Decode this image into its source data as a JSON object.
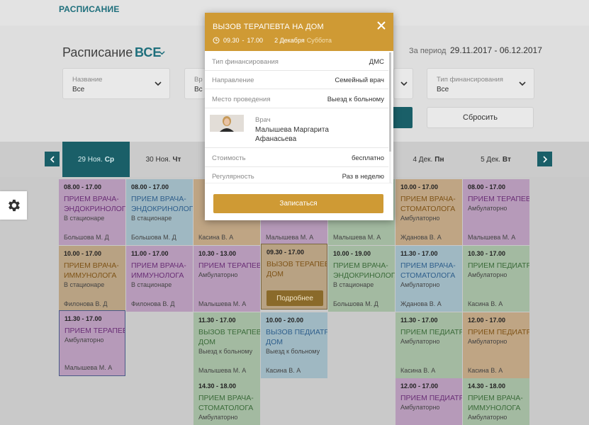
{
  "header": {
    "brand": "РАСПИСАНИЕ"
  },
  "schedule": {
    "title": "Расписание",
    "filter_all": "ВСЕ"
  },
  "period": {
    "label": "За период",
    "value": "29.11.2017 - 06.12.2017"
  },
  "filters": [
    {
      "label": "Название",
      "value": "Все"
    },
    {
      "label": "Вр",
      "value": "Вс"
    },
    {
      "label": "Тип финансирования",
      "value": "Все"
    }
  ],
  "actions": {
    "reset_label": "Сбросить"
  },
  "days": [
    {
      "date": "29 Ноя.",
      "weekday": "Ср"
    },
    {
      "date": "30 Ноя.",
      "weekday": "Чт"
    },
    {
      "date": "4 Дек.",
      "weekday": "Пн"
    },
    {
      "date": "5 Дек.",
      "weekday": "Вт"
    }
  ],
  "cells": [
    {
      "time": "08.00 - 17.00",
      "title": "ПРИЕМ ВРАЧА-ЭНДОКРИНОЛОГА",
      "place": "В стационаре",
      "doctor": "Большова М. Д"
    },
    {
      "time": "10.00 - 17.00",
      "title": "ПРИЕМ ВРАЧА-ИММУНОЛОГА",
      "place": "В стационаре",
      "doctor": "Филонова В. Д"
    },
    {
      "time": "11.30 - 17.00",
      "title": "ПРИЕМ ТЕРАПЕВТА",
      "place": "Амбулаторно",
      "doctor": "Малышева М. А"
    },
    {
      "time": "",
      "title": "ПРИЕМ ВРАЧА-ЭНДОКРИНОЛОГА",
      "place": "В стационаре",
      "doctor": "Большова М. Д"
    },
    {
      "time": "11.00 - 17.00",
      "title": "ПРИЕМ ВРАЧА-ИММУНОЛОГА",
      "place": "В стационаре",
      "doctor": "Филонова В. Д"
    },
    {
      "time": "",
      "title": "",
      "place": "",
      "doctor": "Касина В. А"
    },
    {
      "time": "10.30 - 13.00",
      "title": "ПРИЕМ ТЕРАПЕВТА",
      "place": "Амбулаторно",
      "doctor": "Малышева М. А"
    },
    {
      "time": "11.30 - 17.00",
      "title": "ВЫЗОВ ТЕРАПЕВТА НА ДОМ",
      "place": "Выезд к больному",
      "doctor": "Малышева М. А"
    },
    {
      "time": "14.30 - 18.00",
      "title": "ПРИЕМ ВРАЧА-СТОМАТОЛОГА",
      "place": "Амбулаторно",
      "doctor": ""
    },
    {
      "time": "",
      "title": "",
      "place": "",
      "doctor": "Малышева М. А"
    },
    {
      "time": "09.30 - 17.00",
      "title": "ВЫЗОВ ТЕРАПЕВТА НА ДОМ",
      "place": "",
      "doctor": ""
    },
    {
      "time": "10.00 - 20.00",
      "title": "ВЫЗОВ ПЕДИАТРА НА ДОМ",
      "place": "Выезд к больному",
      "doctor": "Касина В. А"
    },
    {
      "time": "",
      "title": "",
      "place": "",
      "doctor": "Малышева М. А"
    },
    {
      "time": "10.00 - 19.00",
      "title": "ПРИЕМ ВРАЧА-ЭНДОКРИНОЛОГА",
      "place": "В стационаре",
      "doctor": "Большова М. Д"
    },
    {
      "time": "10.00 - 17.00",
      "title": "ПРИЕМ ВРАЧА-СТОМАТОЛОГА",
      "place": "Амбулаторно",
      "doctor": "Жданова В. А"
    },
    {
      "time": "11.30 - 17.00",
      "title": "ПРИЕМ ВРАЧА-СТОМАТОЛОГА",
      "place": "Амбулаторно",
      "doctor": "Жданова В. А"
    },
    {
      "time": "11.30 - 17.00",
      "title": "ПРИЕМ ПЕДИАТРА",
      "place": "Амбулаторно",
      "doctor": "Касина В. А"
    },
    {
      "time": "12.00 - 17.00",
      "title": "ПРИЕМ ПЕДИАТРА",
      "place": "Амбулаторно",
      "doctor": ""
    },
    {
      "time": "08.00 - 17.00",
      "title": "ПРИЕМ ТЕРАПЕВТА",
      "place": "Амбулаторно",
      "doctor": "Малышева М. А"
    },
    {
      "time": "10.30 - 17.00",
      "title": "ПРИЕМ ПЕДИАТРА",
      "place": "Амбулаторно",
      "doctor": "Касина В. А"
    },
    {
      "time": "12.00 - 17.00",
      "title": "ПРИЕМ ПЕДИАТРА",
      "place": "Амбулаторно",
      "doctor": "Касина В. А"
    },
    {
      "time": "14.30 - 18.00",
      "title": "ПРИЕМ ВРАЧА-ИММУНОЛОГА",
      "place": "Амбулаторно",
      "doctor": ""
    }
  ],
  "more_label": "Подробнее",
  "modal": {
    "title": "ВЫЗОВ ТЕРАПЕВТА НА ДОМ",
    "time_start": "09.30",
    "time_end": "17.00",
    "date": "2 Декабря",
    "weekday": "Суббота",
    "rows": [
      {
        "label": "Тип финансирования",
        "value": "ДМС"
      },
      {
        "label": "Направление",
        "value": "Семейный врач"
      },
      {
        "label": "Место проведения",
        "value": "Выезд к больному"
      },
      {
        "label": "Стоимость",
        "value": "бесплатно"
      },
      {
        "label": "Регулярность",
        "value": "Раз в неделю"
      }
    ],
    "doctor_label": "Врач",
    "doctor_name": "Малышева Маргарита Афанасьева",
    "submit_label": "Записаться"
  }
}
